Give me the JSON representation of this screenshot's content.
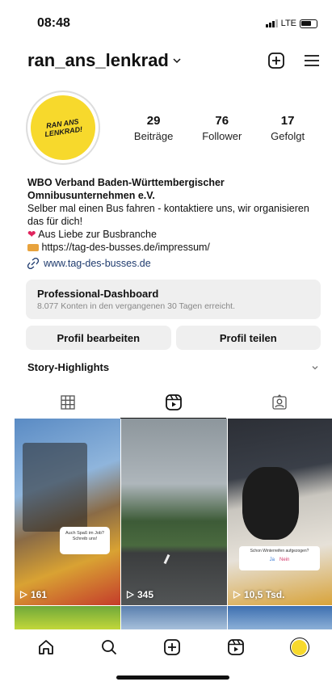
{
  "status": {
    "time": "08:48",
    "network": "LTE"
  },
  "header": {
    "username": "ran_ans_lenkrad"
  },
  "avatar": {
    "logo_line1": "RAN ANS",
    "logo_line2": "LENKRAD!"
  },
  "stats": [
    {
      "value": "29",
      "label": "Beiträge"
    },
    {
      "value": "76",
      "label": "Follower"
    },
    {
      "value": "17",
      "label": "Gefolgt"
    }
  ],
  "bio": {
    "name": "WBO Verband Baden-Württembergischer Omnibusunternehmen e.V.",
    "line1": "Selber mal einen Bus fahren - kontaktiere uns, wir organisieren das für dich!",
    "line2": "Aus Liebe zur Busbranche",
    "line3": "https://tag-des-busses.de/impressum/",
    "link": "www.tag-des-busses.de"
  },
  "dashboard": {
    "title": "Professional-Dashboard",
    "subtitle": "8.077 Konten in den vergangenen 30 Tagen erreicht."
  },
  "buttons": {
    "edit": "Profil bearbeiten",
    "share": "Profil teilen"
  },
  "highlights": {
    "label": "Story-Highlights"
  },
  "posts": [
    {
      "count": "161",
      "sticker": "Auch Spaß im Job? Schreib uns!"
    },
    {
      "count": "345"
    },
    {
      "count": "10,5 Tsd.",
      "sticker": "Schon Winterreifen aufgezogen?",
      "opt1": "Ja",
      "opt2": "Nein"
    }
  ],
  "colors": {
    "accent": "#f7d92c",
    "link": "#1f3b6e",
    "button_bg": "#efefef"
  }
}
